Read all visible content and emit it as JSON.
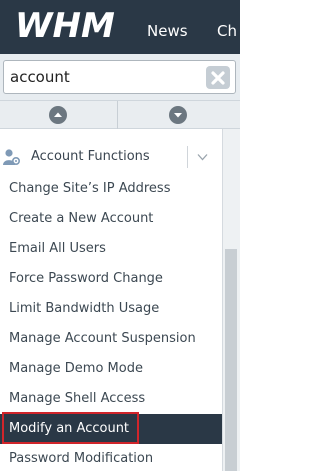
{
  "header": {
    "logo_text": "WHM",
    "nav": [
      {
        "label": "News"
      },
      {
        "label": "Ch"
      }
    ]
  },
  "search": {
    "value": "account",
    "placeholder": ""
  },
  "sidebar": {
    "group": {
      "label": "Account Functions",
      "icon": "user-gear-icon"
    },
    "items": [
      {
        "label": "Change Site’s IP Address"
      },
      {
        "label": "Create a New Account"
      },
      {
        "label": "Email All Users"
      },
      {
        "label": "Force Password Change"
      },
      {
        "label": "Limit Bandwidth Usage"
      },
      {
        "label": "Manage Account Suspension"
      },
      {
        "label": "Manage Demo Mode"
      },
      {
        "label": "Manage Shell Access"
      },
      {
        "label": "Modify an Account",
        "active": true
      },
      {
        "label": "Password Modification"
      }
    ]
  },
  "colors": {
    "header_bg": "#2a3846",
    "highlight": "#d0252b"
  }
}
